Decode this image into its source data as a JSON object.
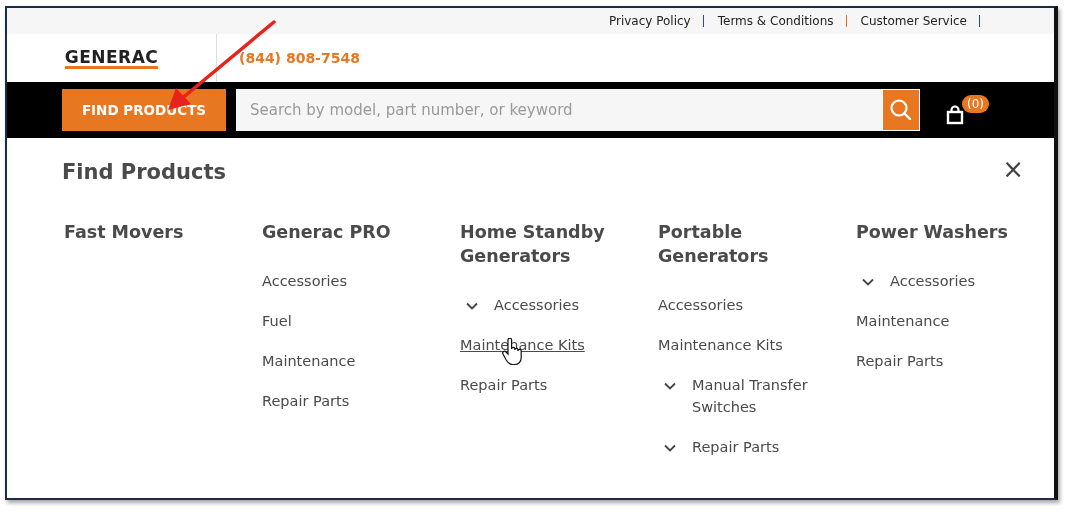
{
  "top_links": [
    "Privacy Policy",
    "Terms & Conditions",
    "Customer Service"
  ],
  "logo": "GENERAC",
  "phone": "(844) 808-7548",
  "find_button": "FIND PRODUCTS",
  "search": {
    "placeholder": "Search by model, part number, or keyword"
  },
  "cart": {
    "count": "(0)"
  },
  "menu": {
    "title": "Find Products",
    "close": "×",
    "columns": [
      {
        "heading": "Fast Movers"
      },
      {
        "heading": "Generac PRO",
        "items": [
          {
            "label": "Accessories",
            "kind": "link",
            "hovered": false
          },
          {
            "label": "Fuel",
            "kind": "link",
            "hovered": false
          },
          {
            "label": "Maintenance",
            "kind": "link",
            "hovered": false
          },
          {
            "label": "Repair Parts",
            "kind": "link",
            "hovered": false
          }
        ]
      },
      {
        "heading": "Home Standby Generators",
        "items": [
          {
            "label": "Accessories",
            "kind": "expandable",
            "hovered": false
          },
          {
            "label": "Maintenance Kits",
            "kind": "link",
            "hovered": true
          },
          {
            "label": "Repair Parts",
            "kind": "link",
            "hovered": false
          }
        ]
      },
      {
        "heading": "Portable Generators",
        "items": [
          {
            "label": "Accessories",
            "kind": "link",
            "hovered": false
          },
          {
            "label": "Maintenance Kits",
            "kind": "link",
            "hovered": false
          },
          {
            "label": "Manual Transfer Switches",
            "kind": "expandable",
            "hovered": false
          },
          {
            "label": "Repair Parts",
            "kind": "expandable",
            "hovered": false
          }
        ]
      },
      {
        "heading": "Power Washers",
        "items": [
          {
            "label": "Accessories",
            "kind": "expandable",
            "hovered": false
          },
          {
            "label": "Maintenance",
            "kind": "link",
            "hovered": false
          },
          {
            "label": "Repair Parts",
            "kind": "link",
            "hovered": false
          }
        ]
      }
    ]
  }
}
